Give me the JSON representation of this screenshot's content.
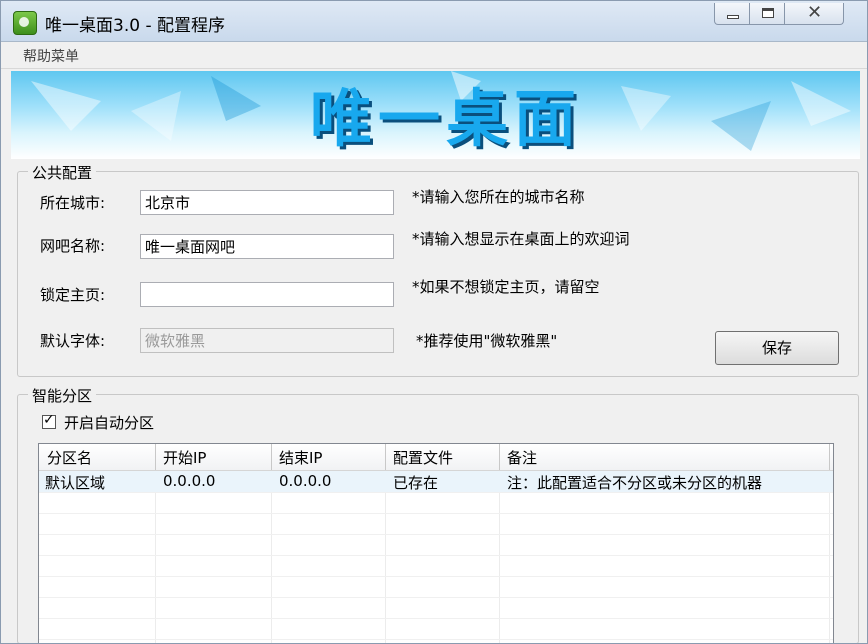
{
  "window": {
    "title": "唯一桌面3.0 - 配置程序",
    "close_glyph": "✕"
  },
  "menu": {
    "help": "帮助菜单"
  },
  "banner": {
    "chars": [
      "唯",
      "一",
      "桌",
      "面"
    ]
  },
  "public_config": {
    "legend": "公共配置",
    "city_label": "所在城市:",
    "city_value": "北京市",
    "city_hint": "*请输入您所在的城市名称",
    "cafe_label": "网吧名称:",
    "cafe_value": "唯一桌面网吧",
    "cafe_hint": "*请输入想显示在桌面上的欢迎词",
    "homepage_label": "锁定主页:",
    "homepage_value": "",
    "homepage_hint": "*如果不想锁定主页，请留空",
    "font_label": "默认字体:",
    "font_value": "微软雅黑",
    "font_hint": "*推荐使用\"微软雅黑\"",
    "save_label": "保存"
  },
  "smart_partition": {
    "legend": "智能分区",
    "auto_label": "开启自动分区",
    "auto_checked": true,
    "columns": [
      "分区名",
      "开始IP",
      "结束IP",
      "配置文件",
      "备注"
    ],
    "rows": [
      [
        "默认区域",
        "0.0.0.0",
        "0.0.0.0",
        "已存在",
        "注：此配置适合不分区或未分区的机器"
      ]
    ]
  },
  "colors": {
    "title_bar": "#c9d9ec",
    "banner_text": "#18a8ee",
    "selected_row": "#eaf4fb"
  },
  "icons": [
    "app-icon",
    "minimize-icon",
    "maximize-icon",
    "close-icon",
    "checkbox-check-icon"
  ]
}
